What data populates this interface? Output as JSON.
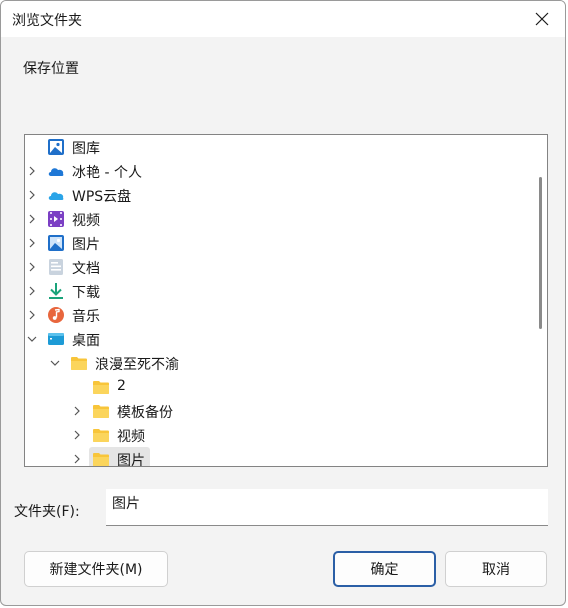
{
  "window": {
    "title": "浏览文件夹"
  },
  "prompt": "保存位置",
  "tree": {
    "items": [
      {
        "label": "图库",
        "icon": "gallery-icon",
        "expander": "none"
      },
      {
        "label": "冰艳 - 个人",
        "icon": "onedrive-cloud-icon",
        "expander": "collapsed"
      },
      {
        "label": "WPS云盘",
        "icon": "wps-cloud-icon",
        "expander": "collapsed"
      },
      {
        "label": "视频",
        "icon": "videos-folder-icon",
        "expander": "collapsed"
      },
      {
        "label": "图片",
        "icon": "pictures-folder-icon",
        "expander": "collapsed"
      },
      {
        "label": "文档",
        "icon": "documents-folder-icon",
        "expander": "collapsed"
      },
      {
        "label": "下载",
        "icon": "downloads-folder-icon",
        "expander": "collapsed"
      },
      {
        "label": "音乐",
        "icon": "music-folder-icon",
        "expander": "collapsed"
      },
      {
        "label": "桌面",
        "icon": "desktop-folder-icon",
        "expander": "expanded"
      },
      {
        "label": "浪漫至死不渝",
        "icon": "folder-icon",
        "expander": "expanded"
      },
      {
        "label": "2",
        "icon": "folder-icon",
        "expander": "none"
      },
      {
        "label": "模板备份",
        "icon": "folder-icon",
        "expander": "collapsed"
      },
      {
        "label": "视频",
        "icon": "folder-icon",
        "expander": "collapsed"
      },
      {
        "label": "图片",
        "icon": "folder-icon",
        "expander": "collapsed",
        "selected": true
      }
    ]
  },
  "folder_field": {
    "label": "文件夹(F):",
    "value": "图片"
  },
  "buttons": {
    "new_folder": "新建文件夹(M)",
    "ok": "确定",
    "cancel": "取消"
  },
  "colors": {
    "accent": "#2b5fa6",
    "folder": "#f8c53a",
    "dialog_bg": "#f3f3f3"
  }
}
